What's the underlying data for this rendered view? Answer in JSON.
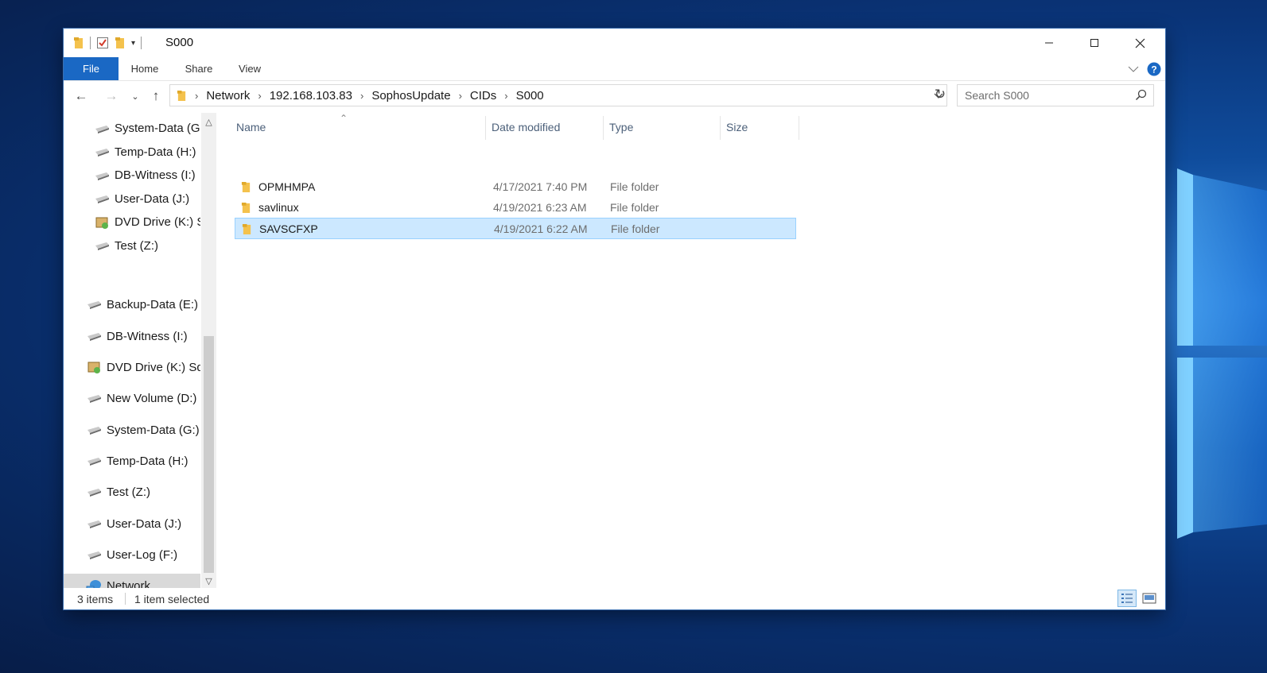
{
  "window": {
    "title": "S000"
  },
  "ribbon": {
    "tabs": [
      "File",
      "Home",
      "Share",
      "View"
    ]
  },
  "address": {
    "crumbs": [
      "Network",
      "192.168.103.83",
      "SophosUpdate",
      "CIDs",
      "S000"
    ],
    "search_placeholder": "Search S000"
  },
  "navpane": {
    "items": [
      {
        "label": "System-Data (G:)",
        "icon": "drive-icon"
      },
      {
        "label": "Temp-Data (H:)",
        "icon": "drive-icon"
      },
      {
        "label": "DB-Witness (I:)",
        "icon": "drive-icon"
      },
      {
        "label": "User-Data (J:)",
        "icon": "drive-icon"
      },
      {
        "label": "DVD Drive (K:) S",
        "icon": "dvd-drive-icon"
      },
      {
        "label": "Test (Z:)",
        "icon": "drive-icon"
      },
      {
        "label": "Backup-Data (E:)",
        "icon": "drive-icon"
      },
      {
        "label": "DB-Witness (I:)",
        "icon": "drive-icon"
      },
      {
        "label": "DVD Drive (K:) Sql",
        "icon": "dvd-drive-icon"
      },
      {
        "label": "New Volume (D:)",
        "icon": "drive-icon"
      },
      {
        "label": "System-Data (G:)",
        "icon": "drive-icon"
      },
      {
        "label": "Temp-Data (H:)",
        "icon": "drive-icon"
      },
      {
        "label": "Test (Z:)",
        "icon": "drive-icon"
      },
      {
        "label": "User-Data (J:)",
        "icon": "drive-icon"
      },
      {
        "label": "User-Log (F:)",
        "icon": "drive-icon"
      },
      {
        "label": "Network",
        "icon": "network-icon"
      }
    ]
  },
  "columns": {
    "name": "Name",
    "date": "Date modified",
    "type": "Type",
    "size": "Size"
  },
  "files": [
    {
      "name": "OPMHMPA",
      "date": "4/17/2021 7:40 PM",
      "type": "File folder",
      "size": ""
    },
    {
      "name": "savlinux",
      "date": "4/19/2021 6:23 AM",
      "type": "File folder",
      "size": ""
    },
    {
      "name": "SAVSCFXP",
      "date": "4/19/2021 6:22 AM",
      "type": "File folder",
      "size": ""
    }
  ],
  "status": {
    "count": "3 items",
    "selected": "1 item selected"
  },
  "colors": {
    "accent": "#1a68c4",
    "selection": "#cce8ff",
    "folder": "#f4c24d"
  }
}
